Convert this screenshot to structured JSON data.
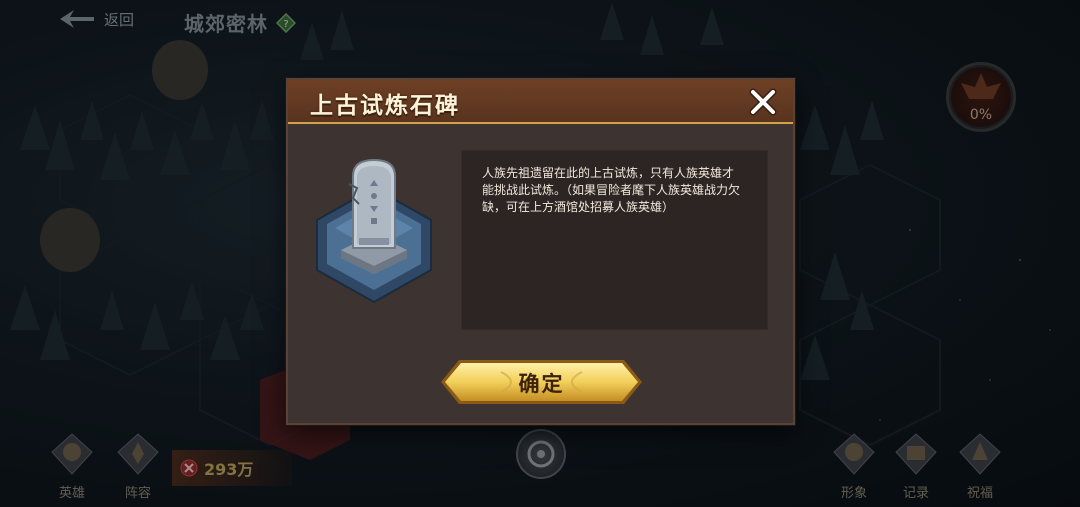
{
  "top_bar": {
    "back_label": "返回",
    "area_name": "城郊密林",
    "area_badge_icon": "diamond-badge-icon"
  },
  "progress": {
    "percent_text": "0%",
    "value": 0
  },
  "bottom_bar": {
    "hero_label": "英雄",
    "lineup_label": "阵容",
    "power_value": "293万",
    "appearance_label": "形象",
    "record_label": "记录",
    "blessing_label": "祝福"
  },
  "dialog": {
    "title": "上古试炼石碑",
    "description": "人族先祖遗留在此的上古试炼，只有人族英雄才能挑战此试炼。（如果冒险者麾下人族英雄战力欠缺，可在上方酒馆处招募人族英雄）",
    "confirm_label": "确定"
  },
  "colors": {
    "dialog_bg": "#3d3330",
    "header_bg": "#6e4024",
    "header_line": "#d6a04a",
    "button_gold": "#f2cf5a",
    "text_light": "#f2e8dc"
  }
}
